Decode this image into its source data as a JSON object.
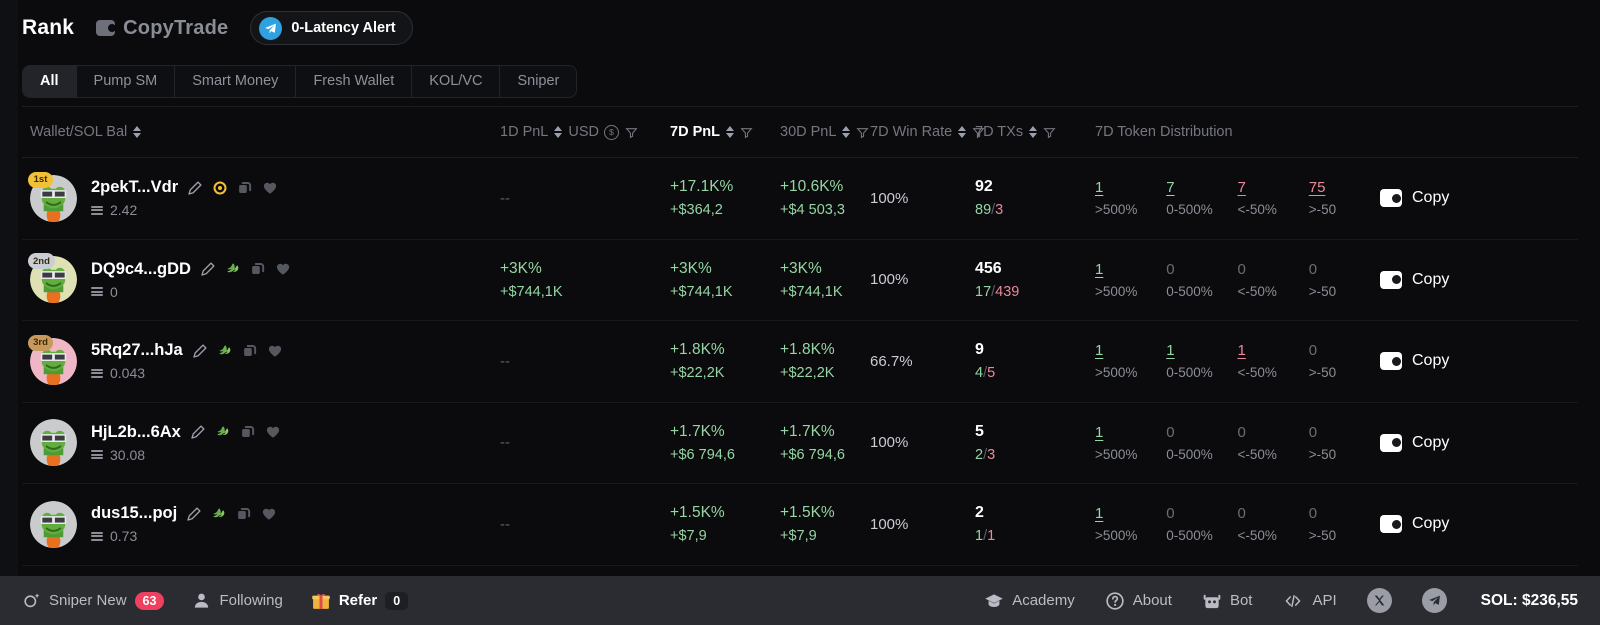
{
  "header": {
    "brand_rank": "Rank",
    "brand_copytrade": "CopyTrade",
    "alert_label": "0-Latency Alert",
    "wallet_icon": "wallet-icon",
    "telegram_icon": "telegram-icon"
  },
  "tabs": [
    {
      "label": "All",
      "active": true
    },
    {
      "label": "Pump SM",
      "active": false
    },
    {
      "label": "Smart Money",
      "active": false
    },
    {
      "label": "Fresh Wallet",
      "active": false
    },
    {
      "label": "KOL/VC",
      "active": false
    },
    {
      "label": "Sniper",
      "active": false
    }
  ],
  "table": {
    "headers": {
      "wallet": "Wallet/SOL Bal",
      "pnl_1d": "1D PnL",
      "usd": "USD",
      "pnl_7d": "7D PnL",
      "pnl_30d": "30D PnL",
      "win_rate_7d": "7D Win Rate",
      "txs_7d": "7D TXs",
      "token_distribution_7d": "7D Token Distribution"
    },
    "distribution_labels": [
      ">500%",
      "0-500%",
      "<-50%",
      ">-50"
    ],
    "copy_label": "Copy",
    "rows": [
      {
        "rank": "1st",
        "rank_badge_color": "#f2c034",
        "avatar_bg": "#c9cbcd",
        "name": "2pekT...Vdr",
        "sol_balance": "2.42",
        "icons": [
          "pencil-icon",
          "target-icon",
          "duplicate-icon",
          "heart-icon"
        ],
        "badge_icon": "target-icon",
        "pnl_1d_pct": "--",
        "pnl_1d_usd": "",
        "pnl_7d_pct": "+17.1K%",
        "pnl_7d_usd": "+$364,2",
        "pnl_30d_pct": "+10.6K%",
        "pnl_30d_usd": "+$4 503,3",
        "win_rate": "100%",
        "txs_total": "92",
        "txs_buy": "89",
        "txs_sell": "3",
        "dist": [
          {
            "value": "1",
            "tone": "g"
          },
          {
            "value": "7",
            "tone": "g"
          },
          {
            "value": "7",
            "tone": "r"
          },
          {
            "value": "75",
            "tone": "r"
          }
        ]
      },
      {
        "rank": "2nd",
        "rank_badge_color": "#c9cdd4",
        "avatar_bg": "#dfe0b4",
        "name": "DQ9c4...gDD",
        "sol_balance": "0",
        "icons": [
          "pencil-icon",
          "leaf-icon",
          "duplicate-icon",
          "heart-icon"
        ],
        "badge_icon": "leaf-icon",
        "pnl_1d_pct": "+3K%",
        "pnl_1d_usd": "+$744,1K",
        "pnl_7d_pct": "+3K%",
        "pnl_7d_usd": "+$744,1K",
        "pnl_30d_pct": "+3K%",
        "pnl_30d_usd": "+$744,1K",
        "win_rate": "100%",
        "txs_total": "456",
        "txs_buy": "17",
        "txs_sell": "439",
        "dist": [
          {
            "value": "1",
            "tone": "g"
          },
          {
            "value": "0",
            "tone": "z"
          },
          {
            "value": "0",
            "tone": "z"
          },
          {
            "value": "0",
            "tone": "z"
          }
        ]
      },
      {
        "rank": "3rd",
        "rank_badge_color": "#c79a5b",
        "avatar_bg": "#efb7c6",
        "name": "5Rq27...hJa",
        "sol_balance": "0.043",
        "icons": [
          "pencil-icon",
          "leaf-icon",
          "duplicate-icon",
          "heart-icon"
        ],
        "badge_icon": "leaf-icon",
        "pnl_1d_pct": "--",
        "pnl_1d_usd": "",
        "pnl_7d_pct": "+1.8K%",
        "pnl_7d_usd": "+$22,2K",
        "pnl_30d_pct": "+1.8K%",
        "pnl_30d_usd": "+$22,2K",
        "win_rate": "66.7%",
        "txs_total": "9",
        "txs_buy": "4",
        "txs_sell": "5",
        "dist": [
          {
            "value": "1",
            "tone": "g"
          },
          {
            "value": "1",
            "tone": "g"
          },
          {
            "value": "1",
            "tone": "r"
          },
          {
            "value": "0",
            "tone": "z"
          }
        ]
      },
      {
        "rank": "",
        "rank_badge_color": "",
        "avatar_bg": "#c9cbcd",
        "name": "HjL2b...6Ax",
        "sol_balance": "30.08",
        "icons": [
          "pencil-icon",
          "leaf-icon",
          "duplicate-icon",
          "heart-icon"
        ],
        "badge_icon": "leaf-icon",
        "pnl_1d_pct": "--",
        "pnl_1d_usd": "",
        "pnl_7d_pct": "+1.7K%",
        "pnl_7d_usd": "+$6 794,6",
        "pnl_30d_pct": "+1.7K%",
        "pnl_30d_usd": "+$6 794,6",
        "win_rate": "100%",
        "txs_total": "5",
        "txs_buy": "2",
        "txs_sell": "3",
        "dist": [
          {
            "value": "1",
            "tone": "g"
          },
          {
            "value": "0",
            "tone": "z"
          },
          {
            "value": "0",
            "tone": "z"
          },
          {
            "value": "0",
            "tone": "z"
          }
        ]
      },
      {
        "rank": "",
        "rank_badge_color": "",
        "avatar_bg": "#c9cbcd",
        "name": "dus15...poj",
        "sol_balance": "0.73",
        "icons": [
          "pencil-icon",
          "leaf-icon",
          "duplicate-icon",
          "heart-icon"
        ],
        "badge_icon": "leaf-icon",
        "pnl_1d_pct": "--",
        "pnl_1d_usd": "",
        "pnl_7d_pct": "+1.5K%",
        "pnl_7d_usd": "+$7,9",
        "pnl_30d_pct": "+1.5K%",
        "pnl_30d_usd": "+$7,9",
        "win_rate": "100%",
        "txs_total": "2",
        "txs_buy": "1",
        "txs_sell": "1",
        "dist": [
          {
            "value": "1",
            "tone": "g"
          },
          {
            "value": "0",
            "tone": "z"
          },
          {
            "value": "0",
            "tone": "z"
          },
          {
            "value": "0",
            "tone": "z"
          }
        ]
      }
    ]
  },
  "footer": {
    "sniper_new": "Sniper New",
    "sniper_count": "63",
    "following": "Following",
    "refer": "Refer",
    "refer_count": "0",
    "academy": "Academy",
    "about": "About",
    "bot": "Bot",
    "api": "API",
    "sol_price": "SOL: $236,55",
    "x_icon": "x-icon",
    "telegram_icon": "telegram-icon"
  },
  "colors": {
    "positive": "#95d6a4",
    "negative": "#e8899a",
    "accent_blue": "#2ea2e0",
    "badge_red": "#ef4060",
    "gold": "#f2c034"
  }
}
